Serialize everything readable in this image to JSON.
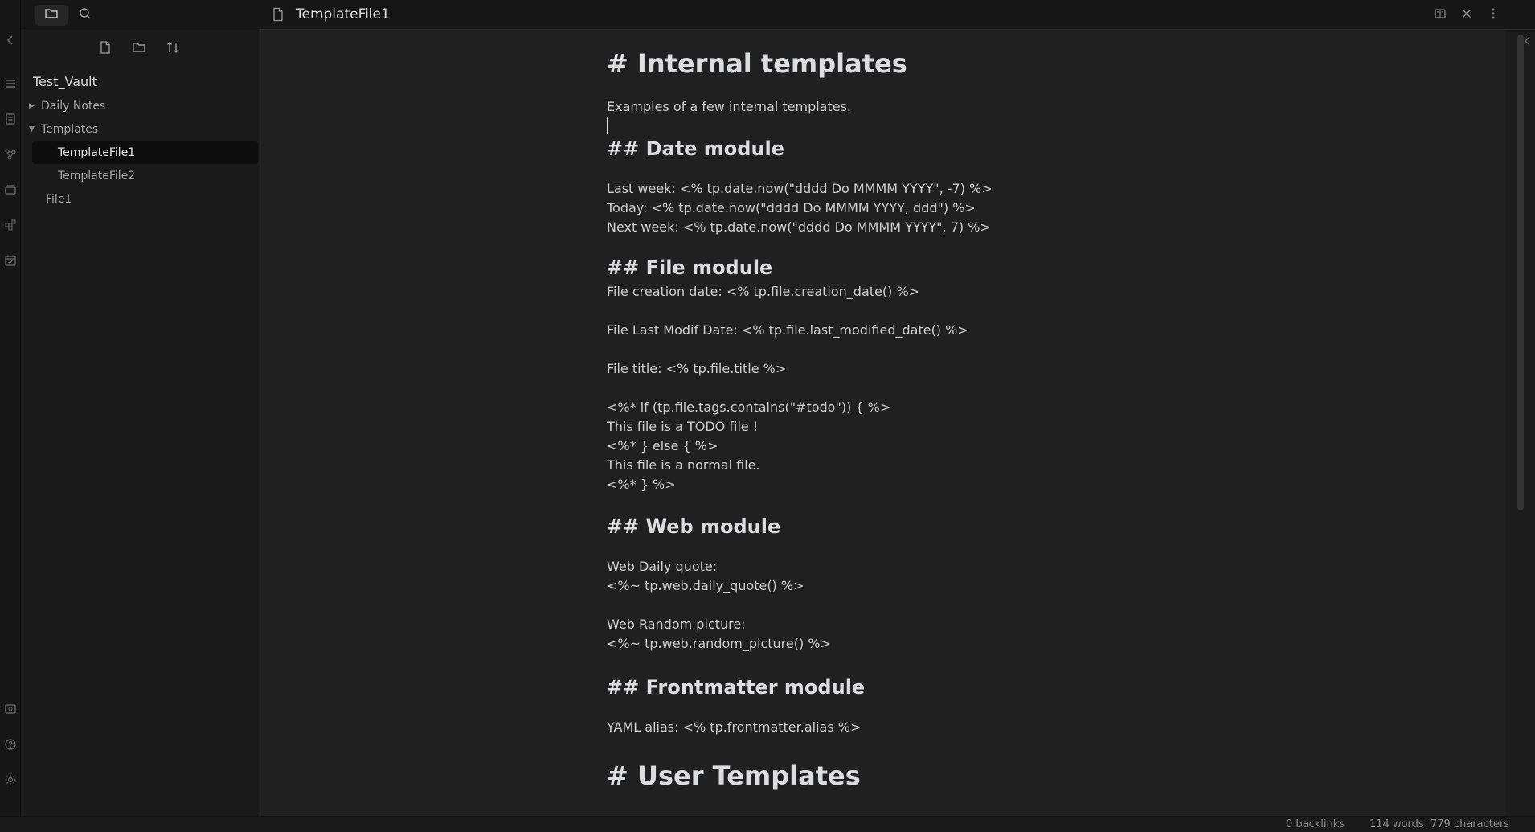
{
  "sidebar": {
    "vault_name": "Test_Vault",
    "items": [
      {
        "label": "Daily Notes",
        "expanded": false
      },
      {
        "label": "Templates",
        "expanded": true
      },
      {
        "label": "TemplateFile1",
        "selected": true
      },
      {
        "label": "TemplateFile2"
      },
      {
        "label": "File1"
      }
    ]
  },
  "tab": {
    "title": "TemplateFile1"
  },
  "document": {
    "h1_internal": "# Internal templates",
    "intro": "Examples of a few internal templates.",
    "h2_date": "## Date module",
    "date_lines": [
      "Last week: <% tp.date.now(\"dddd Do MMMM YYYY\", -7) %>",
      "Today: <% tp.date.now(\"dddd Do MMMM YYYY, ddd\") %>",
      "Next week: <% tp.date.now(\"dddd Do MMMM YYYY\", 7) %>"
    ],
    "h2_file": "## File module",
    "file_creation": "File creation date: <% tp.file.creation_date() %>",
    "file_modif": "File Last Modif Date: <% tp.file.last_modified_date() %>",
    "file_title": "File title: <% tp.file.title %>",
    "todo_lines": [
      "<%* if (tp.file.tags.contains(\"#todo\")) { %>",
      "This file is a TODO file !",
      "<%* } else { %>",
      "This file is a normal file.",
      "<%* } %>"
    ],
    "h2_web": "## Web module",
    "web_quote_label": "Web Daily quote:",
    "web_quote_code": "<%~ tp.web.daily_quote() %>",
    "web_pic_label": "Web Random picture:",
    "web_pic_code": "<%~ tp.web.random_picture() %>",
    "h2_frontmatter": "## Frontmatter module",
    "yaml_alias": "YAML alias: <% tp.frontmatter.alias %>",
    "h1_user": "# User Templates"
  },
  "status": {
    "backlinks": "0 backlinks",
    "words": "114 words",
    "characters": "779 characters"
  },
  "colors": {
    "background": "#202020",
    "sidebar": "#1a1a1a",
    "ribbon": "#161616",
    "text": "#dcddde"
  }
}
